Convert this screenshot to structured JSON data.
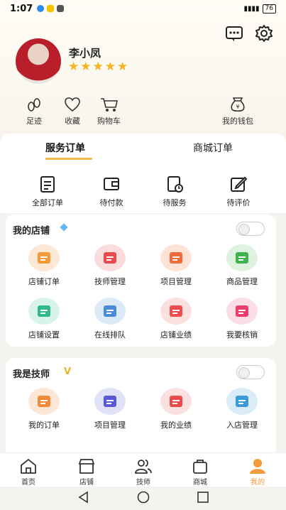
{
  "status_bar": {
    "time": "1:07",
    "battery": "76"
  },
  "profile": {
    "name": "李小凤",
    "stars": "★★★★★"
  },
  "quick_links": [
    {
      "label": "足迹"
    },
    {
      "label": "收藏"
    },
    {
      "label": "购物车"
    },
    {
      "label": "我的钱包"
    }
  ],
  "order_tabs": [
    {
      "label": "服务订单"
    },
    {
      "label": "商城订单"
    }
  ],
  "order_actions": [
    {
      "label": "全部订单"
    },
    {
      "label": "待付款"
    },
    {
      "label": "待服务"
    },
    {
      "label": "待评价"
    }
  ],
  "my_shop": {
    "title": "我的店铺",
    "items": [
      {
        "label": "店铺订单",
        "color": "#f39a3a",
        "bg": "#fde7d5"
      },
      {
        "label": "技师管理",
        "color": "#e84a52",
        "bg": "#fbdcdc"
      },
      {
        "label": "项目管理",
        "color": "#f06b3c",
        "bg": "#fde2d5"
      },
      {
        "label": "商品管理",
        "color": "#3fb24f",
        "bg": "#ddf3df"
      },
      {
        "label": "店铺设置",
        "color": "#30b98a",
        "bg": "#d8f3ea"
      },
      {
        "label": "在线排队",
        "color": "#4a8bd6",
        "bg": "#dceaf8"
      },
      {
        "label": "店铺业绩",
        "color": "#ef4c4c",
        "bg": "#fbe0e0"
      },
      {
        "label": "我要核销",
        "color": "#ea3d6b",
        "bg": "#fbdde6"
      }
    ]
  },
  "technician": {
    "title": "我是技师",
    "items": [
      {
        "label": "我的订单",
        "color": "#f28a3a",
        "bg": "#fde6d6"
      },
      {
        "label": "项目管理",
        "color": "#5a5ad6",
        "bg": "#e1e1f8"
      },
      {
        "label": "我的业绩",
        "color": "#e94a4a",
        "bg": "#fbe0e0"
      },
      {
        "label": "入店管理",
        "color": "#3a9ad8",
        "bg": "#d9ecf8"
      }
    ]
  },
  "tab_bar": [
    {
      "label": "首页"
    },
    {
      "label": "店铺"
    },
    {
      "label": "技师"
    },
    {
      "label": "商城"
    },
    {
      "label": "我的"
    }
  ],
  "accent_color": "#f39a3a"
}
